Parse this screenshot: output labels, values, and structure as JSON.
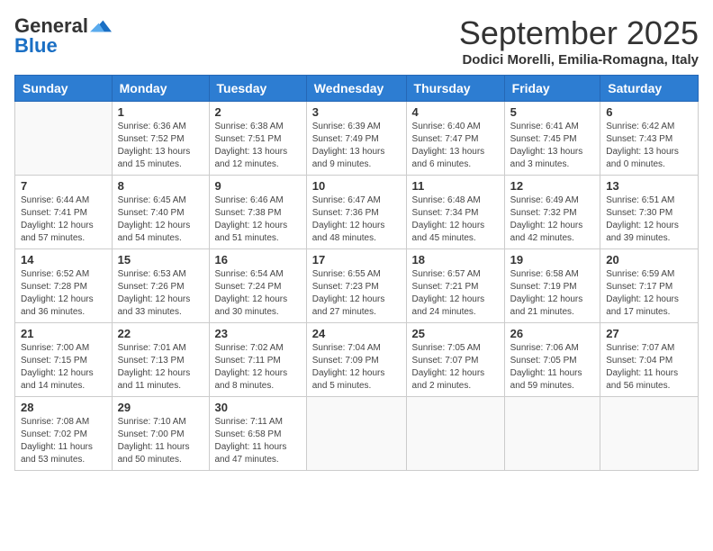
{
  "header": {
    "logo": {
      "general": "General",
      "blue": "Blue"
    },
    "title": "September 2025",
    "location": "Dodici Morelli, Emilia-Romagna, Italy"
  },
  "days_of_week": [
    "Sunday",
    "Monday",
    "Tuesday",
    "Wednesday",
    "Thursday",
    "Friday",
    "Saturday"
  ],
  "weeks": [
    [
      {
        "day": "",
        "info": ""
      },
      {
        "day": "1",
        "info": "Sunrise: 6:36 AM\nSunset: 7:52 PM\nDaylight: 13 hours\nand 15 minutes."
      },
      {
        "day": "2",
        "info": "Sunrise: 6:38 AM\nSunset: 7:51 PM\nDaylight: 13 hours\nand 12 minutes."
      },
      {
        "day": "3",
        "info": "Sunrise: 6:39 AM\nSunset: 7:49 PM\nDaylight: 13 hours\nand 9 minutes."
      },
      {
        "day": "4",
        "info": "Sunrise: 6:40 AM\nSunset: 7:47 PM\nDaylight: 13 hours\nand 6 minutes."
      },
      {
        "day": "5",
        "info": "Sunrise: 6:41 AM\nSunset: 7:45 PM\nDaylight: 13 hours\nand 3 minutes."
      },
      {
        "day": "6",
        "info": "Sunrise: 6:42 AM\nSunset: 7:43 PM\nDaylight: 13 hours\nand 0 minutes."
      }
    ],
    [
      {
        "day": "7",
        "info": "Sunrise: 6:44 AM\nSunset: 7:41 PM\nDaylight: 12 hours\nand 57 minutes."
      },
      {
        "day": "8",
        "info": "Sunrise: 6:45 AM\nSunset: 7:40 PM\nDaylight: 12 hours\nand 54 minutes."
      },
      {
        "day": "9",
        "info": "Sunrise: 6:46 AM\nSunset: 7:38 PM\nDaylight: 12 hours\nand 51 minutes."
      },
      {
        "day": "10",
        "info": "Sunrise: 6:47 AM\nSunset: 7:36 PM\nDaylight: 12 hours\nand 48 minutes."
      },
      {
        "day": "11",
        "info": "Sunrise: 6:48 AM\nSunset: 7:34 PM\nDaylight: 12 hours\nand 45 minutes."
      },
      {
        "day": "12",
        "info": "Sunrise: 6:49 AM\nSunset: 7:32 PM\nDaylight: 12 hours\nand 42 minutes."
      },
      {
        "day": "13",
        "info": "Sunrise: 6:51 AM\nSunset: 7:30 PM\nDaylight: 12 hours\nand 39 minutes."
      }
    ],
    [
      {
        "day": "14",
        "info": "Sunrise: 6:52 AM\nSunset: 7:28 PM\nDaylight: 12 hours\nand 36 minutes."
      },
      {
        "day": "15",
        "info": "Sunrise: 6:53 AM\nSunset: 7:26 PM\nDaylight: 12 hours\nand 33 minutes."
      },
      {
        "day": "16",
        "info": "Sunrise: 6:54 AM\nSunset: 7:24 PM\nDaylight: 12 hours\nand 30 minutes."
      },
      {
        "day": "17",
        "info": "Sunrise: 6:55 AM\nSunset: 7:23 PM\nDaylight: 12 hours\nand 27 minutes."
      },
      {
        "day": "18",
        "info": "Sunrise: 6:57 AM\nSunset: 7:21 PM\nDaylight: 12 hours\nand 24 minutes."
      },
      {
        "day": "19",
        "info": "Sunrise: 6:58 AM\nSunset: 7:19 PM\nDaylight: 12 hours\nand 21 minutes."
      },
      {
        "day": "20",
        "info": "Sunrise: 6:59 AM\nSunset: 7:17 PM\nDaylight: 12 hours\nand 17 minutes."
      }
    ],
    [
      {
        "day": "21",
        "info": "Sunrise: 7:00 AM\nSunset: 7:15 PM\nDaylight: 12 hours\nand 14 minutes."
      },
      {
        "day": "22",
        "info": "Sunrise: 7:01 AM\nSunset: 7:13 PM\nDaylight: 12 hours\nand 11 minutes."
      },
      {
        "day": "23",
        "info": "Sunrise: 7:02 AM\nSunset: 7:11 PM\nDaylight: 12 hours\nand 8 minutes."
      },
      {
        "day": "24",
        "info": "Sunrise: 7:04 AM\nSunset: 7:09 PM\nDaylight: 12 hours\nand 5 minutes."
      },
      {
        "day": "25",
        "info": "Sunrise: 7:05 AM\nSunset: 7:07 PM\nDaylight: 12 hours\nand 2 minutes."
      },
      {
        "day": "26",
        "info": "Sunrise: 7:06 AM\nSunset: 7:05 PM\nDaylight: 11 hours\nand 59 minutes."
      },
      {
        "day": "27",
        "info": "Sunrise: 7:07 AM\nSunset: 7:04 PM\nDaylight: 11 hours\nand 56 minutes."
      }
    ],
    [
      {
        "day": "28",
        "info": "Sunrise: 7:08 AM\nSunset: 7:02 PM\nDaylight: 11 hours\nand 53 minutes."
      },
      {
        "day": "29",
        "info": "Sunrise: 7:10 AM\nSunset: 7:00 PM\nDaylight: 11 hours\nand 50 minutes."
      },
      {
        "day": "30",
        "info": "Sunrise: 7:11 AM\nSunset: 6:58 PM\nDaylight: 11 hours\nand 47 minutes."
      },
      {
        "day": "",
        "info": ""
      },
      {
        "day": "",
        "info": ""
      },
      {
        "day": "",
        "info": ""
      },
      {
        "day": "",
        "info": ""
      }
    ]
  ]
}
